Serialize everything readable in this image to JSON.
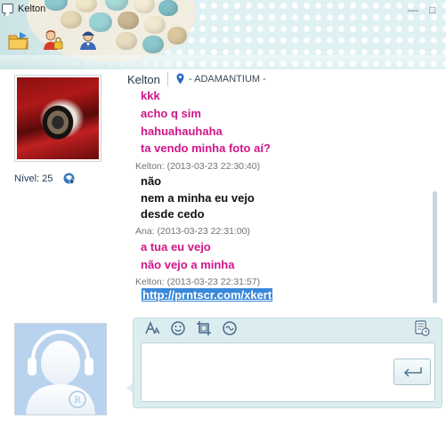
{
  "window": {
    "title": "Kelton",
    "minimize_glyph": "—",
    "maximize_glyph": "□"
  },
  "toolbar": {
    "icons": [
      "folder-icon",
      "user-lock-icon",
      "user-settings-icon"
    ]
  },
  "contact": {
    "name": "Kelton",
    "location": "- ADAMANTIUM -",
    "level_label": "Nível: 25"
  },
  "chat": {
    "lines": [
      {
        "kind": "text",
        "color": "#d0158a",
        "text": "kkk"
      },
      {
        "kind": "text",
        "color": "#d0158a",
        "text": "acho q sim"
      },
      {
        "kind": "text",
        "color": "#d0158a",
        "text": "hahuahauhaha"
      },
      {
        "kind": "text",
        "color": "#d0158a",
        "text": "ta vendo minha foto aí?"
      },
      {
        "kind": "meta",
        "text": "Kelton: (2013-03-23 22:30:40)"
      },
      {
        "kind": "text",
        "color": "#111111",
        "text": "não"
      },
      {
        "kind": "text",
        "color": "#111111",
        "text": "nem a minha eu vejo"
      },
      {
        "kind": "text",
        "color": "#111111",
        "text": "desde cedo"
      },
      {
        "kind": "meta",
        "text": "Ana: (2013-03-23 22:31:00)"
      },
      {
        "kind": "text",
        "color": "#d0158a",
        "text": "a tua eu vejo"
      },
      {
        "kind": "text",
        "color": "#d0158a",
        "text": "não vejo a minha"
      },
      {
        "kind": "meta",
        "text": "Kelton: (2013-03-23 22:31:57)"
      }
    ],
    "link_text": "http://prntscr.com/xkert"
  },
  "composer": {
    "tools": [
      "font-icon",
      "emoticon-icon",
      "screenshot-crop-icon",
      "nudge-icon"
    ],
    "history_icon": "history-icon",
    "send_icon": "send-arrow-icon",
    "input_value": ""
  },
  "colors": {
    "header_bg": "#dff1f3",
    "panel_bg": "#dcedf0",
    "pink_text": "#d0158a",
    "link_highlight": "#3a88d8"
  }
}
